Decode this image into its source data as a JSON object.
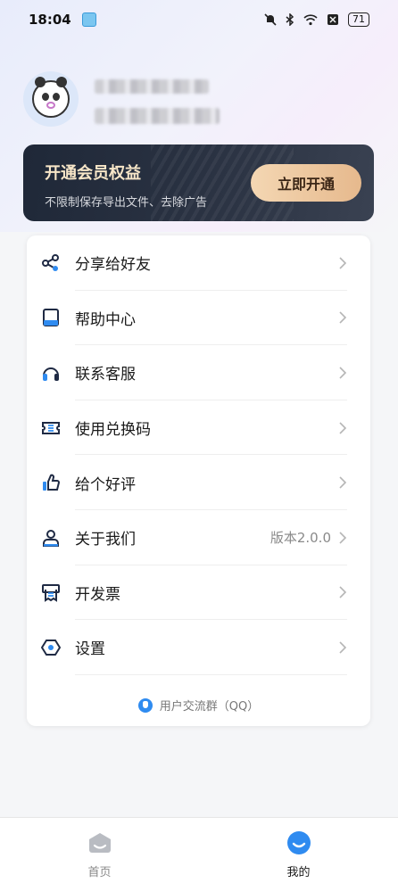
{
  "status_bar": {
    "time": "18:04",
    "battery": "71"
  },
  "vip": {
    "title": "开通会员权益",
    "subtitle": "不限制保存导出文件、去除广告",
    "button": "立即开通"
  },
  "menu": {
    "items": [
      {
        "label": "分享给好友",
        "icon": "share-icon"
      },
      {
        "label": "帮助中心",
        "icon": "book-icon"
      },
      {
        "label": "联系客服",
        "icon": "headphones-icon"
      },
      {
        "label": "使用兑换码",
        "icon": "coupon-icon"
      },
      {
        "label": "给个好评",
        "icon": "thumbs-up-icon"
      },
      {
        "label": "关于我们",
        "icon": "user-icon",
        "extra": "版本2.0.0"
      },
      {
        "label": "开发票",
        "icon": "invoice-icon"
      },
      {
        "label": "设置",
        "icon": "settings-icon"
      }
    ],
    "group_link": "用户交流群（QQ）"
  },
  "tabbar": {
    "tabs": [
      {
        "label": "首页",
        "icon": "home-icon"
      },
      {
        "label": "我的",
        "icon": "mine-icon",
        "active": true
      }
    ]
  },
  "colors": {
    "accent": "#2f8bf0",
    "vip_card": "#1f2838",
    "vip_button": "#f4d7b3"
  }
}
